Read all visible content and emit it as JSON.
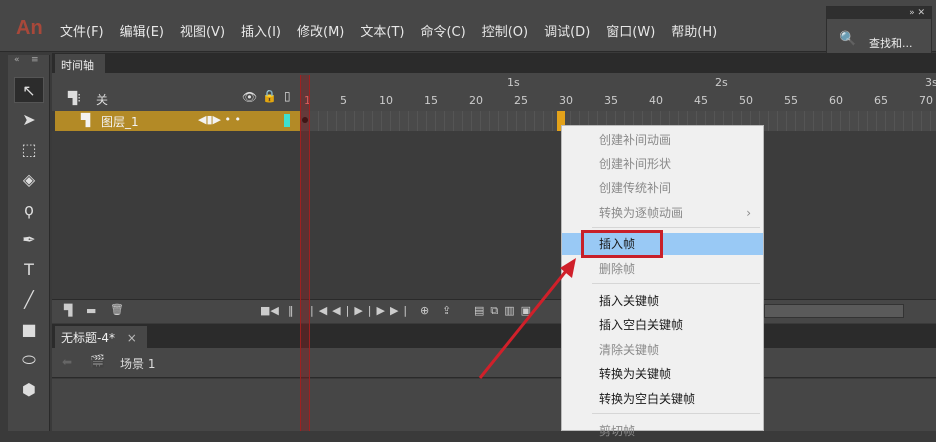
{
  "app": {
    "logo": "An"
  },
  "menubar": [
    "文件(F)",
    "编辑(E)",
    "视图(V)",
    "插入(I)",
    "修改(M)",
    "文本(T)",
    "命令(C)",
    "控制(O)",
    "调试(D)",
    "窗口(W)",
    "帮助(H)"
  ],
  "search_panel": {
    "label": "查找和...",
    "icon": "search-help-icon"
  },
  "timeline": {
    "tab": "时间轴",
    "header_layer_label": "关",
    "layer_name": "图层_1",
    "seconds": [
      "1s",
      "2s",
      "3s"
    ],
    "frame_numbers": [
      "1",
      "5",
      "10",
      "15",
      "20",
      "25",
      "30",
      "35",
      "40",
      "45",
      "50",
      "55",
      "60",
      "65",
      "70"
    ],
    "selected_frame": 30,
    "current_frame": 1
  },
  "document": {
    "tab": "无标题-4*",
    "close": "×",
    "scene": "场景 1"
  },
  "context_menu": {
    "items": [
      {
        "label": "创建补间动画",
        "disabled": true
      },
      {
        "label": "创建补间形状",
        "disabled": true
      },
      {
        "label": "创建传统补间",
        "disabled": true
      },
      {
        "label": "转换为逐帧动画",
        "disabled": true,
        "submenu": "›"
      },
      {
        "label": "插入帧",
        "highlighted": true
      },
      {
        "label": "删除帧",
        "disabled": true
      },
      {
        "label": "插入关键帧"
      },
      {
        "label": "插入空白关键帧"
      },
      {
        "label": "清除关键帧",
        "disabled": true
      },
      {
        "label": "转换为关键帧"
      },
      {
        "label": "转换为空白关键帧"
      },
      {
        "label": "剪切帧",
        "disabled": true
      }
    ]
  },
  "colors": {
    "layer_highlight": "#b38a26",
    "menu_highlight": "#99c9f5",
    "annotation": "#c8202a"
  }
}
